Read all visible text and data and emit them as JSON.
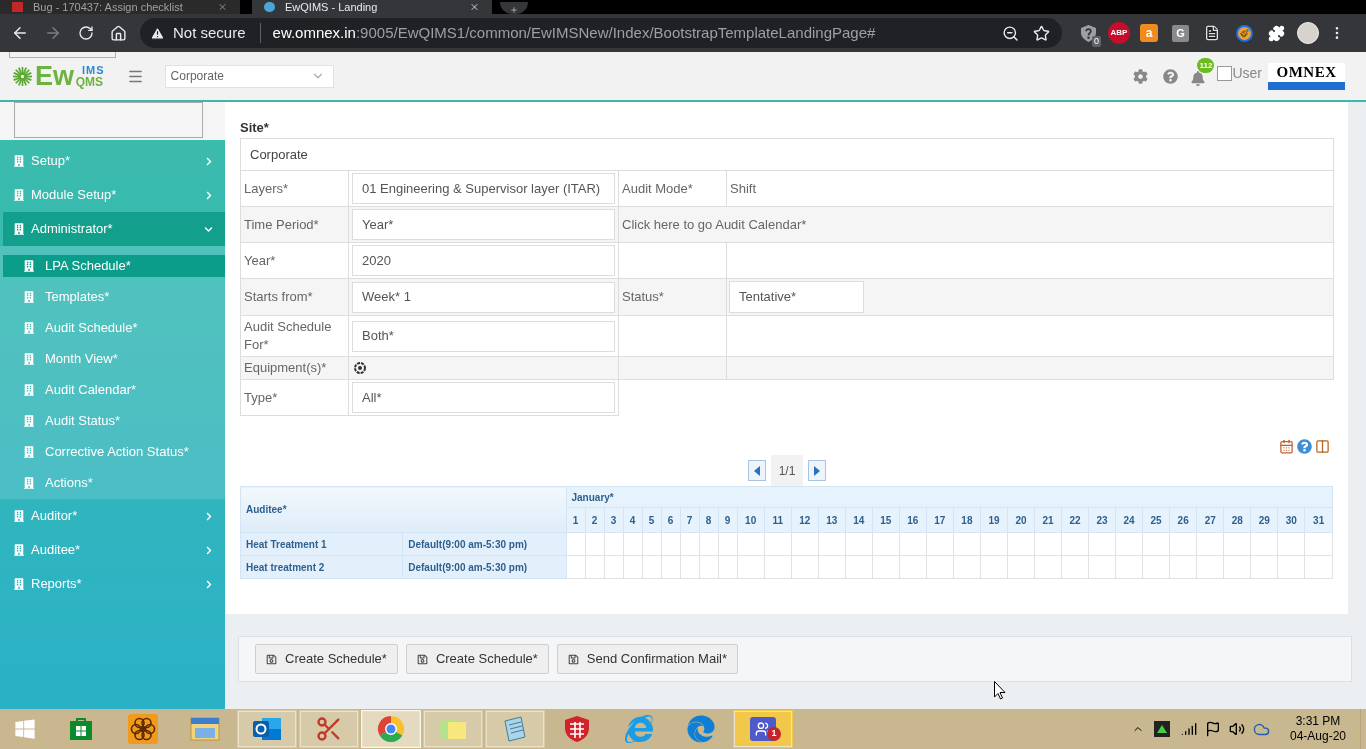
{
  "browser": {
    "tabs": [
      {
        "title": "Bug - 170437: Assign checklist",
        "selected": false
      },
      {
        "title": "EwQIMS - Landing",
        "selected": true
      }
    ],
    "address_bar": {
      "security": "Not secure",
      "host": "ew.omnex.in",
      "path": ":9005/EwQIMS1/common/EwIMSNew/Index/BootstrapTemplateLandingPage#"
    },
    "extensions": [
      {
        "kind": "shield",
        "badge": "0"
      },
      {
        "kind": "abp",
        "label": "ABP"
      },
      {
        "kind": "bag",
        "label": "a"
      },
      {
        "kind": "letter",
        "label": "G"
      },
      {
        "kind": "document"
      },
      {
        "kind": "brush"
      },
      {
        "kind": "puzzle"
      },
      {
        "kind": "avatar"
      }
    ]
  },
  "header": {
    "logo": {
      "text": "Ew",
      "sub": "QMS",
      "sup": "IMS"
    },
    "site_select": {
      "value": "Corporate"
    },
    "notifications": {
      "count": "112"
    },
    "user": {
      "label": "User",
      "checked": false
    },
    "brand": "OMNEX"
  },
  "sidebar": {
    "items": [
      {
        "label": "Setup*",
        "expanded": false
      },
      {
        "label": "Module Setup*",
        "expanded": false
      },
      {
        "label": "Administrator*",
        "expanded": true,
        "children": [
          {
            "label": "LPA Schedule*",
            "selected": true
          },
          {
            "label": "Templates*",
            "selected": false
          },
          {
            "label": "Audit Schedule*",
            "selected": false
          },
          {
            "label": "Month View*",
            "selected": false
          },
          {
            "label": "Audit Calendar*",
            "selected": false
          },
          {
            "label": "Audit Status*",
            "selected": false
          },
          {
            "label": "Corrective Action Status*",
            "selected": false
          },
          {
            "label": "Actions*",
            "selected": false
          }
        ]
      },
      {
        "label": "Auditor*",
        "expanded": false
      },
      {
        "label": "Auditee*",
        "expanded": false
      },
      {
        "label": "Reports*",
        "expanded": false
      }
    ]
  },
  "form": {
    "site": {
      "label": "Site*",
      "value": "Corporate"
    },
    "rows": [
      {
        "label": "Layers*",
        "kind": "select",
        "value": "01 Engineering & Supervisor layer (ITAR)",
        "right": {
          "kind": "pair",
          "label": "Audit Mode*",
          "value": "Shift"
        }
      },
      {
        "label": "Time Period*",
        "kind": "select",
        "value": "Year*",
        "right": {
          "kind": "link",
          "text": "Click here to go Audit Calendar*"
        }
      },
      {
        "label": "Year*",
        "kind": "select",
        "value": "2020",
        "right": {
          "kind": "empty"
        }
      },
      {
        "label": "Starts from*",
        "kind": "select",
        "value": "Week* 1",
        "right": {
          "kind": "field",
          "label": "Status*",
          "value": "Tentative*"
        }
      },
      {
        "label": "Audit Schedule For*",
        "kind": "select",
        "value": "Both*",
        "right": {
          "kind": "empty"
        }
      },
      {
        "label": "Equipment(s)*",
        "kind": "picker",
        "right": {
          "kind": "empty"
        }
      },
      {
        "label": "Type*",
        "kind": "select",
        "value": "All*"
      }
    ]
  },
  "pager": {
    "text": "1/1"
  },
  "calendar": {
    "auditee_header": "Auditee*",
    "month": "January*",
    "days": [
      "1",
      "2",
      "3",
      "4",
      "5",
      "6",
      "7",
      "8",
      "9",
      "10",
      "11",
      "12",
      "13",
      "14",
      "15",
      "16",
      "17",
      "18",
      "19",
      "20",
      "21",
      "22",
      "23",
      "24",
      "25",
      "26",
      "27",
      "28",
      "29",
      "30",
      "31"
    ],
    "rows": [
      {
        "name": "Heat Treatment 1",
        "shift": "Default(9:00 am-5:30 pm)"
      },
      {
        "name": "Heat treatment 2",
        "shift": "Default(9:00 am-5:30 pm)"
      }
    ]
  },
  "actions": [
    {
      "label": "Create Schedule*"
    },
    {
      "label": "Create Schedule*"
    },
    {
      "label": "Send Confirmation Mail*"
    }
  ],
  "taskbar": {
    "apps": [
      {
        "kind": "store",
        "running": false,
        "selected": false,
        "flashing": false
      },
      {
        "kind": "flower",
        "running": false,
        "selected": false,
        "flashing": false
      },
      {
        "kind": "folder",
        "running": false,
        "selected": false,
        "flashing": false
      },
      {
        "kind": "mail",
        "running": true,
        "selected": false,
        "flashing": false
      },
      {
        "kind": "scissors",
        "running": true,
        "selected": false,
        "flashing": false
      },
      {
        "kind": "browser",
        "running": true,
        "selected": true,
        "flashing": false
      },
      {
        "kind": "notes",
        "running": true,
        "selected": false,
        "flashing": false
      },
      {
        "kind": "notepad",
        "running": true,
        "selected": false,
        "flashing": false
      },
      {
        "kind": "shield",
        "running": false,
        "selected": false,
        "flashing": false
      },
      {
        "kind": "ie",
        "running": false,
        "selected": false,
        "flashing": false
      },
      {
        "kind": "edge",
        "running": false,
        "selected": false,
        "flashing": false
      },
      {
        "kind": "chat",
        "running": true,
        "selected": false,
        "flashing": true,
        "badge": "1"
      }
    ],
    "clock": {
      "time": "3:31 PM",
      "date": "04-Aug-20"
    }
  }
}
